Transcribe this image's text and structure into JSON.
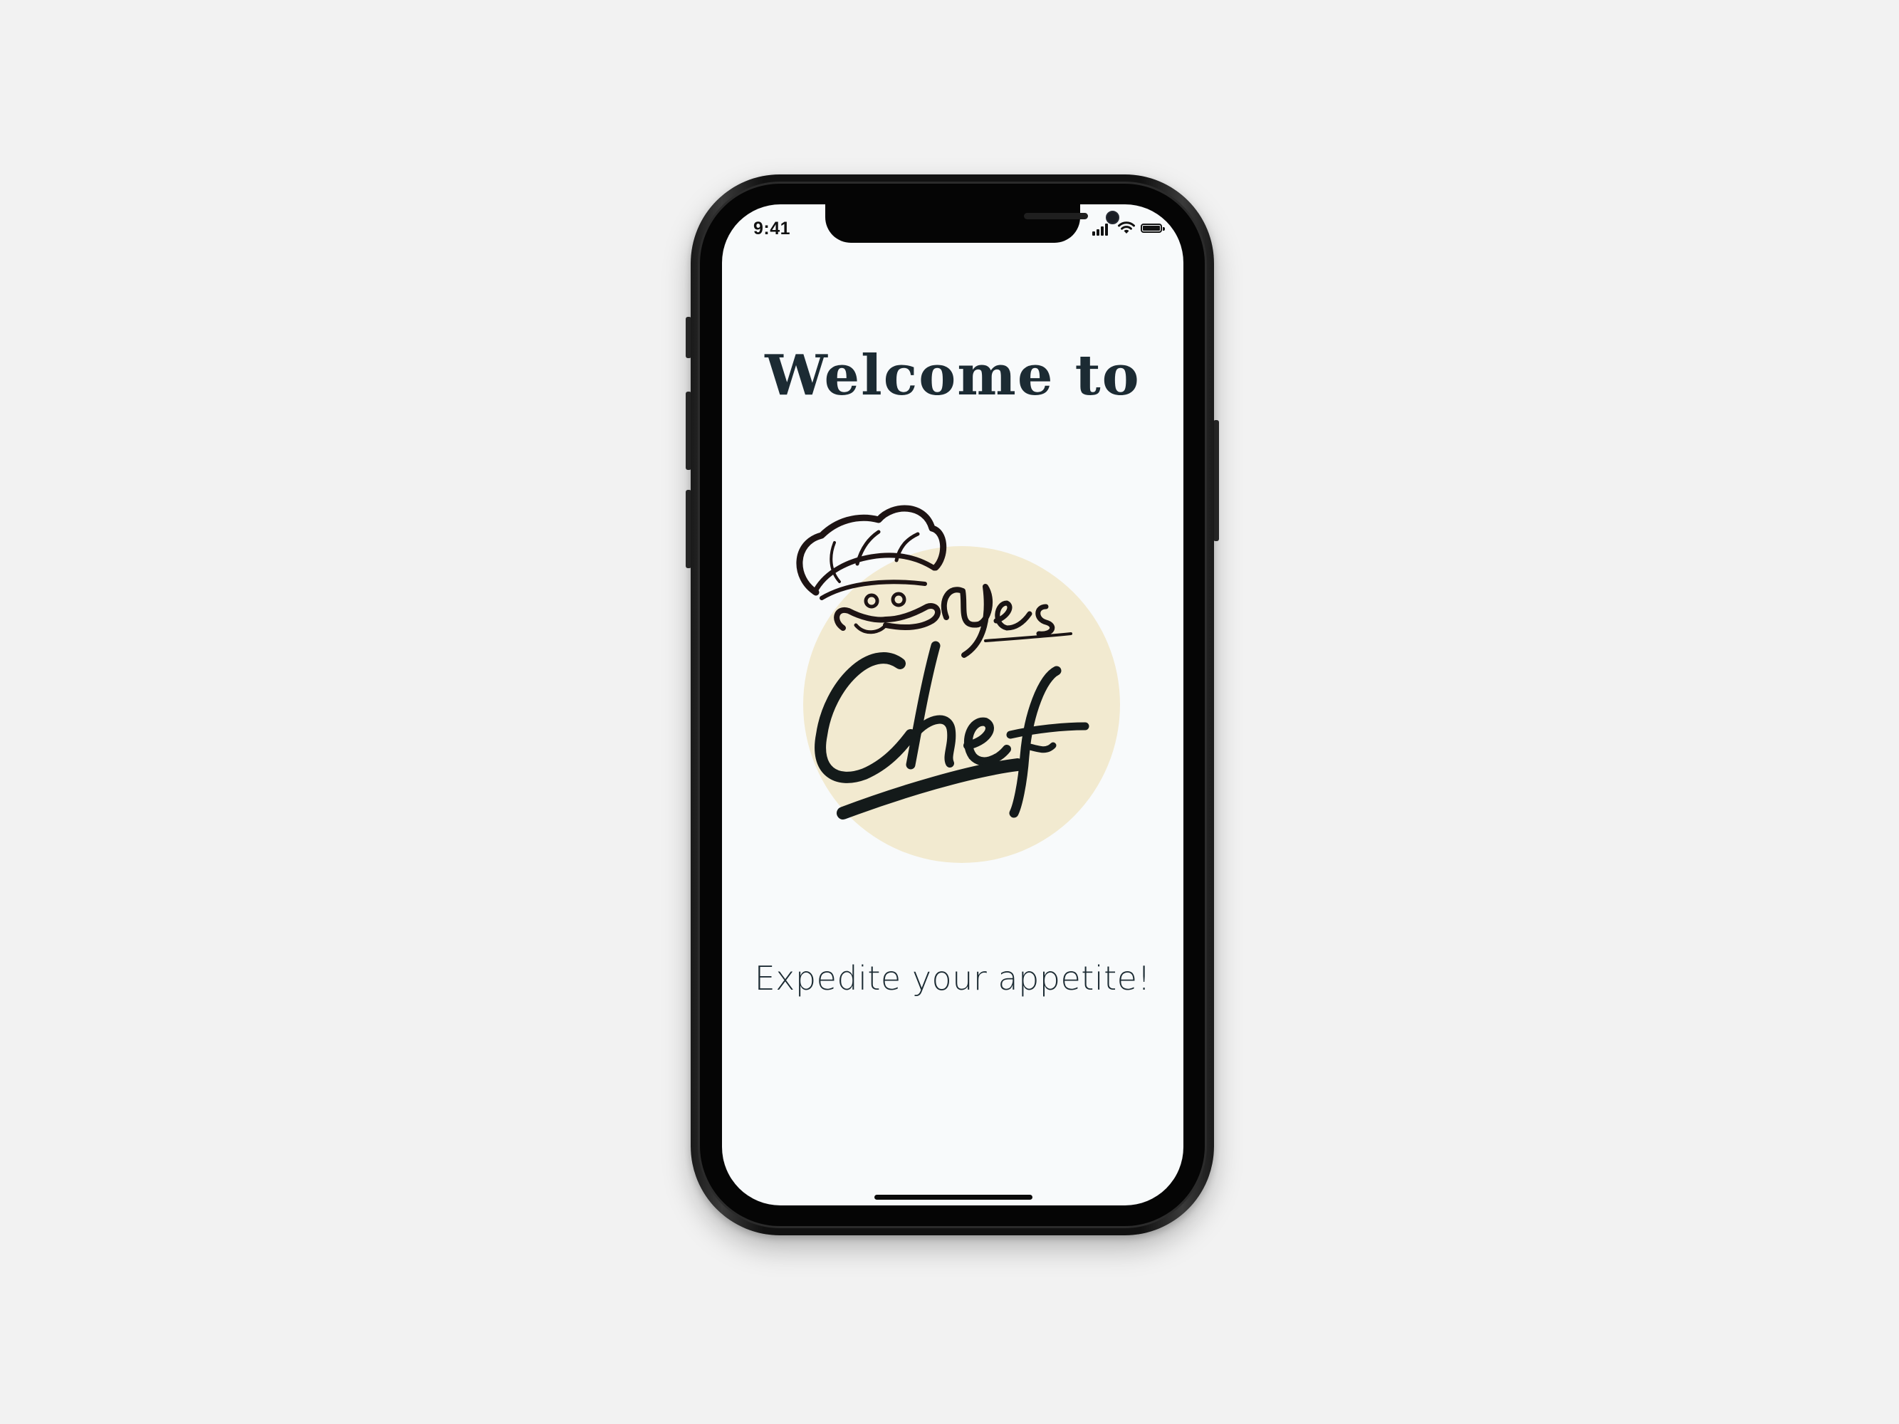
{
  "status_bar": {
    "time": "9:41"
  },
  "screen": {
    "welcome_title": "Welcome to",
    "logo": {
      "brand_name": "Yes Chef",
      "circle_color": "#f2ead0"
    },
    "tagline": "Expedite your appetite!"
  },
  "colors": {
    "background": "#f2f2f2",
    "screen": "#f8fafb",
    "text": "#1c2b33",
    "logo_ink": "#141a1a"
  },
  "icons": [
    "cellular-signal-icon",
    "wifi-icon",
    "battery-icon",
    "chef-hat-icon"
  ]
}
